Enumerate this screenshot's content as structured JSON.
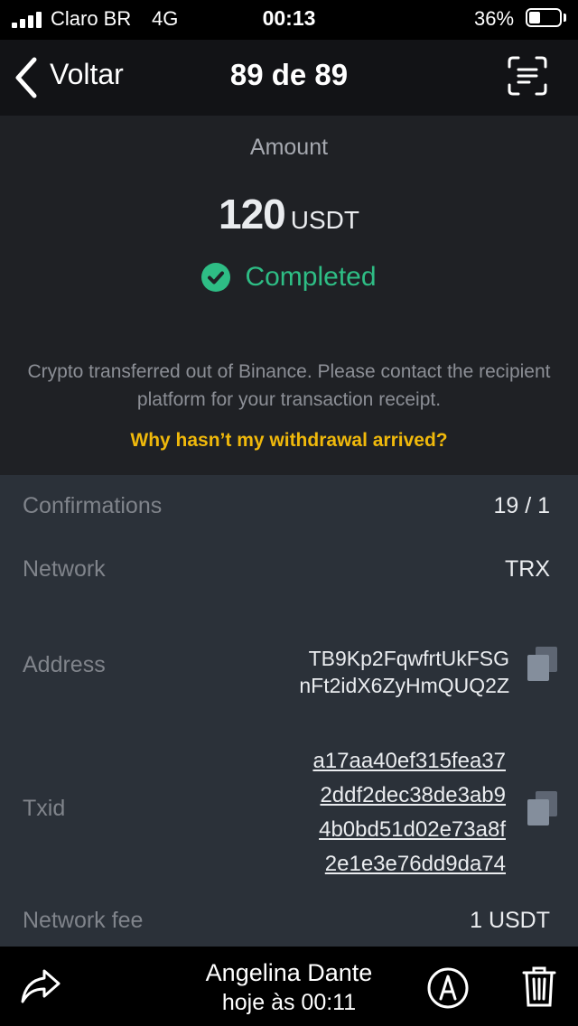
{
  "status_bar": {
    "carrier": "Claro BR",
    "network": "4G",
    "time": "00:13",
    "battery_percent": "36%",
    "battery_level": 0.36
  },
  "nav": {
    "back_label": "Voltar",
    "title": "89 de 89",
    "icons": [
      "chevron-left-icon",
      "scan-text-icon"
    ]
  },
  "summary": {
    "amount_label": "Amount",
    "amount_value": "120",
    "amount_unit": "USDT",
    "status": "Completed",
    "description": "Crypto transferred out of Binance. Please contact the recipient platform for your transaction receipt.",
    "help_link": "Why hasn’t my withdrawal arrived?"
  },
  "details": {
    "confirmations_label": "Confirmations",
    "confirmations_value": "19 / 1",
    "network_label": "Network",
    "network_value": "TRX",
    "address_label": "Address",
    "address_lines": [
      "TB9Kp2FqwfrtUkFSG",
      "nFt2idX6ZyHmQUQ2Z"
    ],
    "txid_label": "Txid",
    "txid_lines": [
      "a17aa40ef315fea37",
      "2ddf2dec38de3ab9",
      "4b0bd51d02e73a8f",
      "2e1e3e76dd9da74"
    ],
    "fee_label": "Network fee",
    "fee_value": "1 USDT"
  },
  "toolbar": {
    "sender": "Angelina Dante",
    "timestamp": "hoje às 00:11",
    "icons": [
      "share-icon",
      "markup-icon",
      "trash-icon"
    ]
  },
  "colors": {
    "success": "#2ebd85",
    "accent": "#f0b90b",
    "panel": "#1f2125",
    "details_bg": "#2b3139"
  }
}
